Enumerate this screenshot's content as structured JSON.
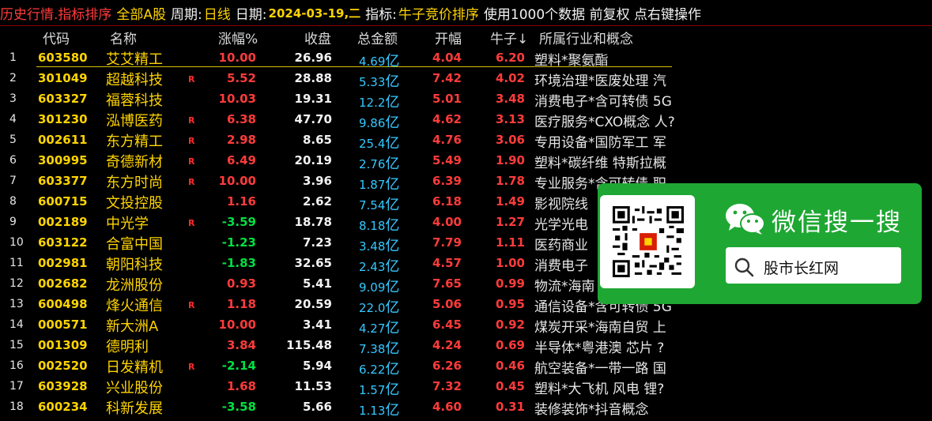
{
  "titlebar": {
    "part1": "历史行情.指标排序",
    "part2": "全部A股",
    "period_label": "周期:",
    "period_value": "日线",
    "date_label": "日期:",
    "date_value": "2024-03-19,二",
    "indicator_label": "指标:",
    "indicator_value": "牛子竞价排序",
    "info": "使用1000个数据 前复权 点右键操作"
  },
  "columns": {
    "code": "代码",
    "name": "名称",
    "change": "涨幅%",
    "close": "收盘",
    "amount": "总金额",
    "open": "开幅",
    "niuzi": "牛子↓",
    "industry": "所属行业和概念"
  },
  "rows": [
    {
      "idx": "1",
      "code": "603580",
      "name": "艾艾精工",
      "r": "",
      "change": "10.00",
      "dir": "up",
      "close": "26.96",
      "amt": "4.69",
      "open": "4.04",
      "niuzi": "6.20",
      "concept": "塑料*聚氨酯"
    },
    {
      "idx": "2",
      "code": "301049",
      "name": "超越科技",
      "r": "R",
      "change": "5.52",
      "dir": "up",
      "close": "28.88",
      "amt": "5.33",
      "open": "7.42",
      "niuzi": "4.02",
      "concept": "环境治理*医废处理 汽"
    },
    {
      "idx": "3",
      "code": "603327",
      "name": "福蓉科技",
      "r": "",
      "change": "10.03",
      "dir": "up",
      "close": "19.31",
      "amt": "12.2",
      "open": "5.01",
      "niuzi": "3.48",
      "concept": "消费电子*含可转债 5G"
    },
    {
      "idx": "4",
      "code": "301230",
      "name": "泓博医药",
      "r": "R",
      "change": "6.38",
      "dir": "up",
      "close": "47.70",
      "amt": "9.86",
      "open": "4.62",
      "niuzi": "3.13",
      "concept": "医疗服务*CXO概念 人?"
    },
    {
      "idx": "5",
      "code": "002611",
      "name": "东方精工",
      "r": "R",
      "change": "2.98",
      "dir": "up",
      "close": "8.65",
      "amt": "25.4",
      "open": "4.76",
      "niuzi": "3.06",
      "concept": "专用设备*国防军工 军"
    },
    {
      "idx": "6",
      "code": "300995",
      "name": "奇德新材",
      "r": "R",
      "change": "6.49",
      "dir": "up",
      "close": "20.19",
      "amt": "2.76",
      "open": "5.49",
      "niuzi": "1.90",
      "concept": "塑料*碳纤维 特斯拉概"
    },
    {
      "idx": "7",
      "code": "603377",
      "name": "东方时尚",
      "r": "R",
      "change": "10.00",
      "dir": "up",
      "close": "3.96",
      "amt": "1.87",
      "open": "6.39",
      "niuzi": "1.78",
      "concept": "专业服务*含可转债 职"
    },
    {
      "idx": "8",
      "code": "600715",
      "name": "文投控股",
      "r": "",
      "change": "1.16",
      "dir": "up",
      "close": "2.62",
      "amt": "7.54",
      "open": "6.18",
      "niuzi": "1.49",
      "concept": "影视院线"
    },
    {
      "idx": "9",
      "code": "002189",
      "name": "中光学",
      "r": "R",
      "change": "-3.59",
      "dir": "down",
      "close": "18.78",
      "amt": "8.18",
      "open": "4.00",
      "niuzi": "1.27",
      "concept": "光学光电"
    },
    {
      "idx": "10",
      "code": "603122",
      "name": "合富中国",
      "r": "",
      "change": "-1.23",
      "dir": "down",
      "close": "7.23",
      "amt": "3.48",
      "open": "7.79",
      "niuzi": "1.11",
      "concept": "医药商业"
    },
    {
      "idx": "11",
      "code": "002981",
      "name": "朝阳科技",
      "r": "",
      "change": "-1.83",
      "dir": "down",
      "close": "32.65",
      "amt": "2.43",
      "open": "4.57",
      "niuzi": "1.00",
      "concept": "消费电子"
    },
    {
      "idx": "12",
      "code": "002682",
      "name": "龙洲股份",
      "r": "",
      "change": "0.93",
      "dir": "up",
      "close": "5.41",
      "amt": "9.09",
      "open": "7.65",
      "niuzi": "0.99",
      "concept": "物流*海南"
    },
    {
      "idx": "13",
      "code": "600498",
      "name": "烽火通信",
      "r": "R",
      "change": "1.18",
      "dir": "up",
      "close": "20.59",
      "amt": "22.0",
      "open": "5.06",
      "niuzi": "0.95",
      "concept": "通信设备*含可转债 5G"
    },
    {
      "idx": "14",
      "code": "000571",
      "name": "新大洲A",
      "r": "",
      "change": "10.00",
      "dir": "up",
      "close": "3.41",
      "amt": "4.27",
      "open": "6.45",
      "niuzi": "0.92",
      "concept": "煤炭开采*海南自贸 上"
    },
    {
      "idx": "15",
      "code": "001309",
      "name": "德明利",
      "r": "",
      "change": "3.84",
      "dir": "up",
      "close": "115.48",
      "amt": "7.38",
      "open": "4.24",
      "niuzi": "0.69",
      "concept": "半导体*粤港澳 芯片 ?"
    },
    {
      "idx": "16",
      "code": "002520",
      "name": "日发精机",
      "r": "R",
      "change": "-2.14",
      "dir": "down",
      "close": "5.94",
      "amt": "6.22",
      "open": "6.26",
      "niuzi": "0.46",
      "concept": "航空装备*一带一路 国"
    },
    {
      "idx": "17",
      "code": "603928",
      "name": "兴业股份",
      "r": "",
      "change": "1.68",
      "dir": "up",
      "close": "11.53",
      "amt": "1.57",
      "open": "7.32",
      "niuzi": "0.45",
      "concept": "塑料*大飞机 风电 锂?"
    },
    {
      "idx": "18",
      "code": "600234",
      "name": "科新发展",
      "r": "",
      "change": "-3.58",
      "dir": "down",
      "close": "5.66",
      "amt": "1.13",
      "open": "4.60",
      "niuzi": "0.31",
      "concept": "装修装饰*抖音概念"
    }
  ],
  "unit_yi": "亿",
  "ad": {
    "title": "微信搜一搜",
    "search_text": "股市长红网"
  },
  "colors": {
    "up": "#ff3b3b",
    "down": "#00e040",
    "code": "#ffd400",
    "amount": "#35c8ff",
    "ad_green": "#1fa733"
  }
}
